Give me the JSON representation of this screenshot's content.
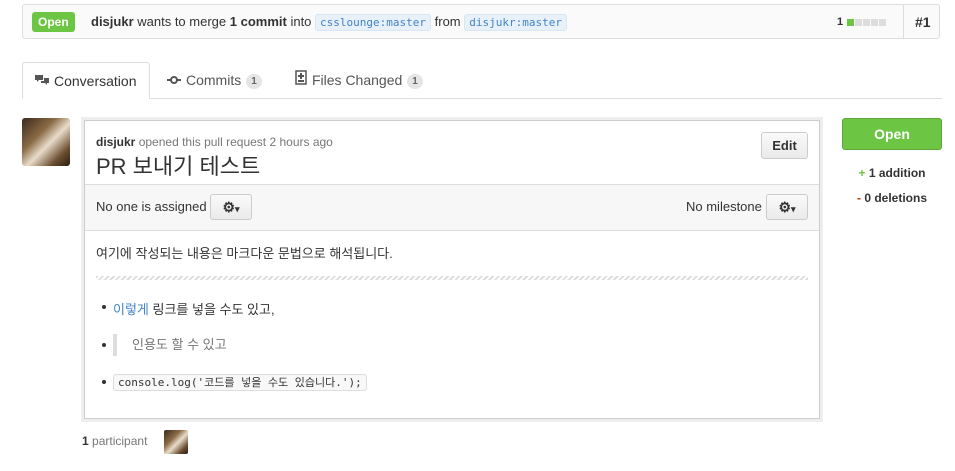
{
  "header": {
    "state": "Open",
    "author": "disjukr",
    "merge_text_a": "wants to merge",
    "commit_count": "1 commit",
    "merge_text_b": "into",
    "base_branch_repo": "csslounge",
    "base_branch_name": ":master",
    "merge_text_c": "from",
    "head_branch_repo": "disjukr",
    "head_branch_name": ":master",
    "diffstat_count": "1",
    "pr_number": "#1"
  },
  "tabs": [
    {
      "label": "Conversation",
      "icon": "comment-discussion-icon"
    },
    {
      "label": "Commits",
      "count": "1",
      "icon": "commit-icon"
    },
    {
      "label": "Files Changed",
      "count": "1",
      "icon": "diff-icon"
    }
  ],
  "discussion": {
    "author": "disjukr",
    "meta_suffix": "opened this pull request 2 hours ago",
    "title": "PR 보내기 테스트",
    "edit_label": "Edit",
    "assignee_text": "No one is assigned",
    "milestone_text": "No milestone",
    "body": "여기에 작성되는 내용은 마크다운 문법으로 해석됩니다.",
    "list": {
      "link_text": "이렇게",
      "link_rest": " 링크를 넣을 수도 있고,",
      "quote_text": "인용도 할 수 있고",
      "code_text": "console.log('코드를 넣을 수도 있습니다.');"
    }
  },
  "participants": {
    "count": "1",
    "label": "participant"
  },
  "sidebar": {
    "state_button": "Open",
    "additions_sign": "+",
    "additions_text": "1 addition",
    "deletions_sign": "-",
    "deletions_text": "0 deletions"
  },
  "colors": {
    "open_green": "#6cc644",
    "link_blue": "#4183c4",
    "deletion_red": "#bd2c00"
  }
}
